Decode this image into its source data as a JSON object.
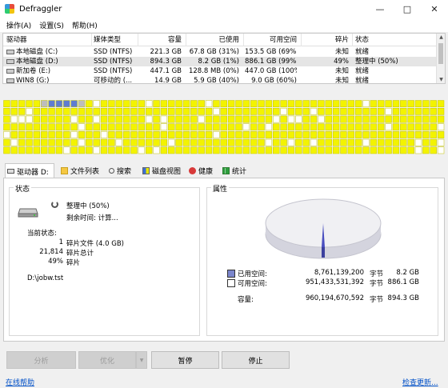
{
  "window": {
    "title": "Defraggler"
  },
  "menu": [
    {
      "label": "操作(A)"
    },
    {
      "label": "设置(S)"
    },
    {
      "label": "帮助(H)"
    }
  ],
  "drive_list": {
    "columns": [
      "驱动器",
      "媒体类型",
      "容量",
      "已使用",
      "可用空间",
      "碎片",
      "状态"
    ],
    "rows": [
      {
        "drive": "本地磁盘 (C:)",
        "media": "SSD (NTFS)",
        "capacity": "221.3 GB",
        "used": "67.8 GB (31%)",
        "free": "153.5 GB (69%)",
        "frag": "未知",
        "status": "就绪"
      },
      {
        "drive": "本地磁盘 (D:)",
        "media": "SSD (NTFS)",
        "capacity": "894.3 GB",
        "used": "8.2 GB (1%)",
        "free": "886.1 GB (99%)",
        "frag": "49%",
        "status": "整理中 (50%)"
      },
      {
        "drive": "新加卷 (E:)",
        "media": "SSD (NTFS)",
        "capacity": "447.1 GB",
        "used": "128.8 MB (0%)",
        "free": "447.0 GB (100%)",
        "frag": "未知",
        "status": "就绪"
      },
      {
        "drive": "WIN8 (G:)",
        "media": "可移动的 (...",
        "capacity": "14.9 GB",
        "used": "5.9 GB (40%)",
        "free": "9.0 GB (60%)",
        "frag": "未知",
        "status": "就绪"
      }
    ]
  },
  "disk_map": {
    "rows": 7,
    "cols": 59,
    "colors": {
      "free": "#f3f300",
      "used": "#ffffff",
      "frag": "#5e7cd1",
      "active": "#bdbdbd"
    }
  },
  "tabs": [
    {
      "label": "驱动器 D:",
      "icon": "drive-icon"
    },
    {
      "label": "文件列表",
      "icon": "folder-icon"
    },
    {
      "label": "搜索",
      "icon": "search-icon"
    },
    {
      "label": "磁盘视图",
      "icon": "disk-view-icon"
    },
    {
      "label": "健康",
      "icon": "health-icon"
    },
    {
      "label": "统计",
      "icon": "stats-icon"
    }
  ],
  "status_panel": {
    "title": "状态",
    "state": "整理中 (50%)",
    "remaining": "剩余时间: 计算...",
    "current_label": "当前状态:",
    "stats": [
      {
        "value": "1",
        "label": "碎片文件 (4.0 GB)"
      },
      {
        "value": "21,814",
        "label": "碎片总计"
      },
      {
        "value": "49%",
        "label": "碎片"
      }
    ],
    "current_file": "D:\\jobw.tst"
  },
  "properties_panel": {
    "title": "属性",
    "used": {
      "label": "已用空间:",
      "bytes": "8,761,139,200",
      "unit": "字节",
      "size": "8.2 GB",
      "color": "#7b86cc"
    },
    "free": {
      "label": "可用空间:",
      "bytes": "951,433,531,392",
      "unit": "字节",
      "size": "886.1 GB",
      "color": "#ffffff"
    },
    "capacity": {
      "label": "容量:",
      "bytes": "960,194,670,592",
      "unit": "字节",
      "size": "894.3 GB"
    }
  },
  "buttons": {
    "analyze": "分析",
    "optimize": "优化",
    "pause": "暂停",
    "stop": "停止"
  },
  "links": {
    "help": "在线帮助",
    "update": "检查更新..."
  }
}
